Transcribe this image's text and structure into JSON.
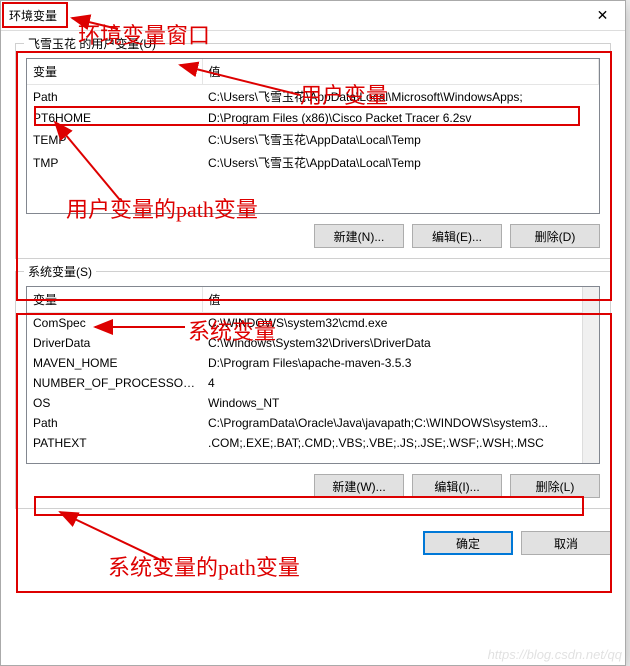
{
  "window": {
    "title": "环境变量",
    "close_label": "✕"
  },
  "userSection": {
    "legend": "飞雪玉花 的用户变量(U)",
    "cols": {
      "var": "变量",
      "val": "值"
    },
    "rows": [
      {
        "var": "Path",
        "val": "C:\\Users\\飞雪玉花\\AppData\\Local\\Microsoft\\WindowsApps;"
      },
      {
        "var": "PT6HOME",
        "val": "D:\\Program Files (x86)\\Cisco Packet Tracer 6.2sv"
      },
      {
        "var": "TEMP",
        "val": "C:\\Users\\飞雪玉花\\AppData\\Local\\Temp"
      },
      {
        "var": "TMP",
        "val": "C:\\Users\\飞雪玉花\\AppData\\Local\\Temp"
      }
    ],
    "buttons": {
      "new": "新建(N)...",
      "edit": "编辑(E)...",
      "del": "删除(D)"
    }
  },
  "sysSection": {
    "legend": "系统变量(S)",
    "cols": {
      "var": "变量",
      "val": "值"
    },
    "rows": [
      {
        "var": "ComSpec",
        "val": "C:\\WINDOWS\\system32\\cmd.exe"
      },
      {
        "var": "DriverData",
        "val": "C:\\Windows\\System32\\Drivers\\DriverData"
      },
      {
        "var": "MAVEN_HOME",
        "val": "D:\\Program Files\\apache-maven-3.5.3"
      },
      {
        "var": "NUMBER_OF_PROCESSORS",
        "val": "4"
      },
      {
        "var": "OS",
        "val": "Windows_NT"
      },
      {
        "var": "Path",
        "val": "C:\\ProgramData\\Oracle\\Java\\javapath;C:\\WINDOWS\\system3..."
      },
      {
        "var": "PATHEXT",
        "val": ".COM;.EXE;.BAT;.CMD;.VBS;.VBE;.JS;.JSE;.WSF;.WSH;.MSC"
      }
    ],
    "buttons": {
      "new": "新建(W)...",
      "edit": "编辑(I)...",
      "del": "删除(L)"
    }
  },
  "footer": {
    "ok": "确定",
    "cancel": "取消"
  },
  "annotations": {
    "a1": "环境变量窗口",
    "a2": "用户变量",
    "a3": "用户变量的path变量",
    "a4": "系统变量",
    "a5": "系统变量的path变量"
  },
  "watermark": "https://blog.csdn.net/qq"
}
